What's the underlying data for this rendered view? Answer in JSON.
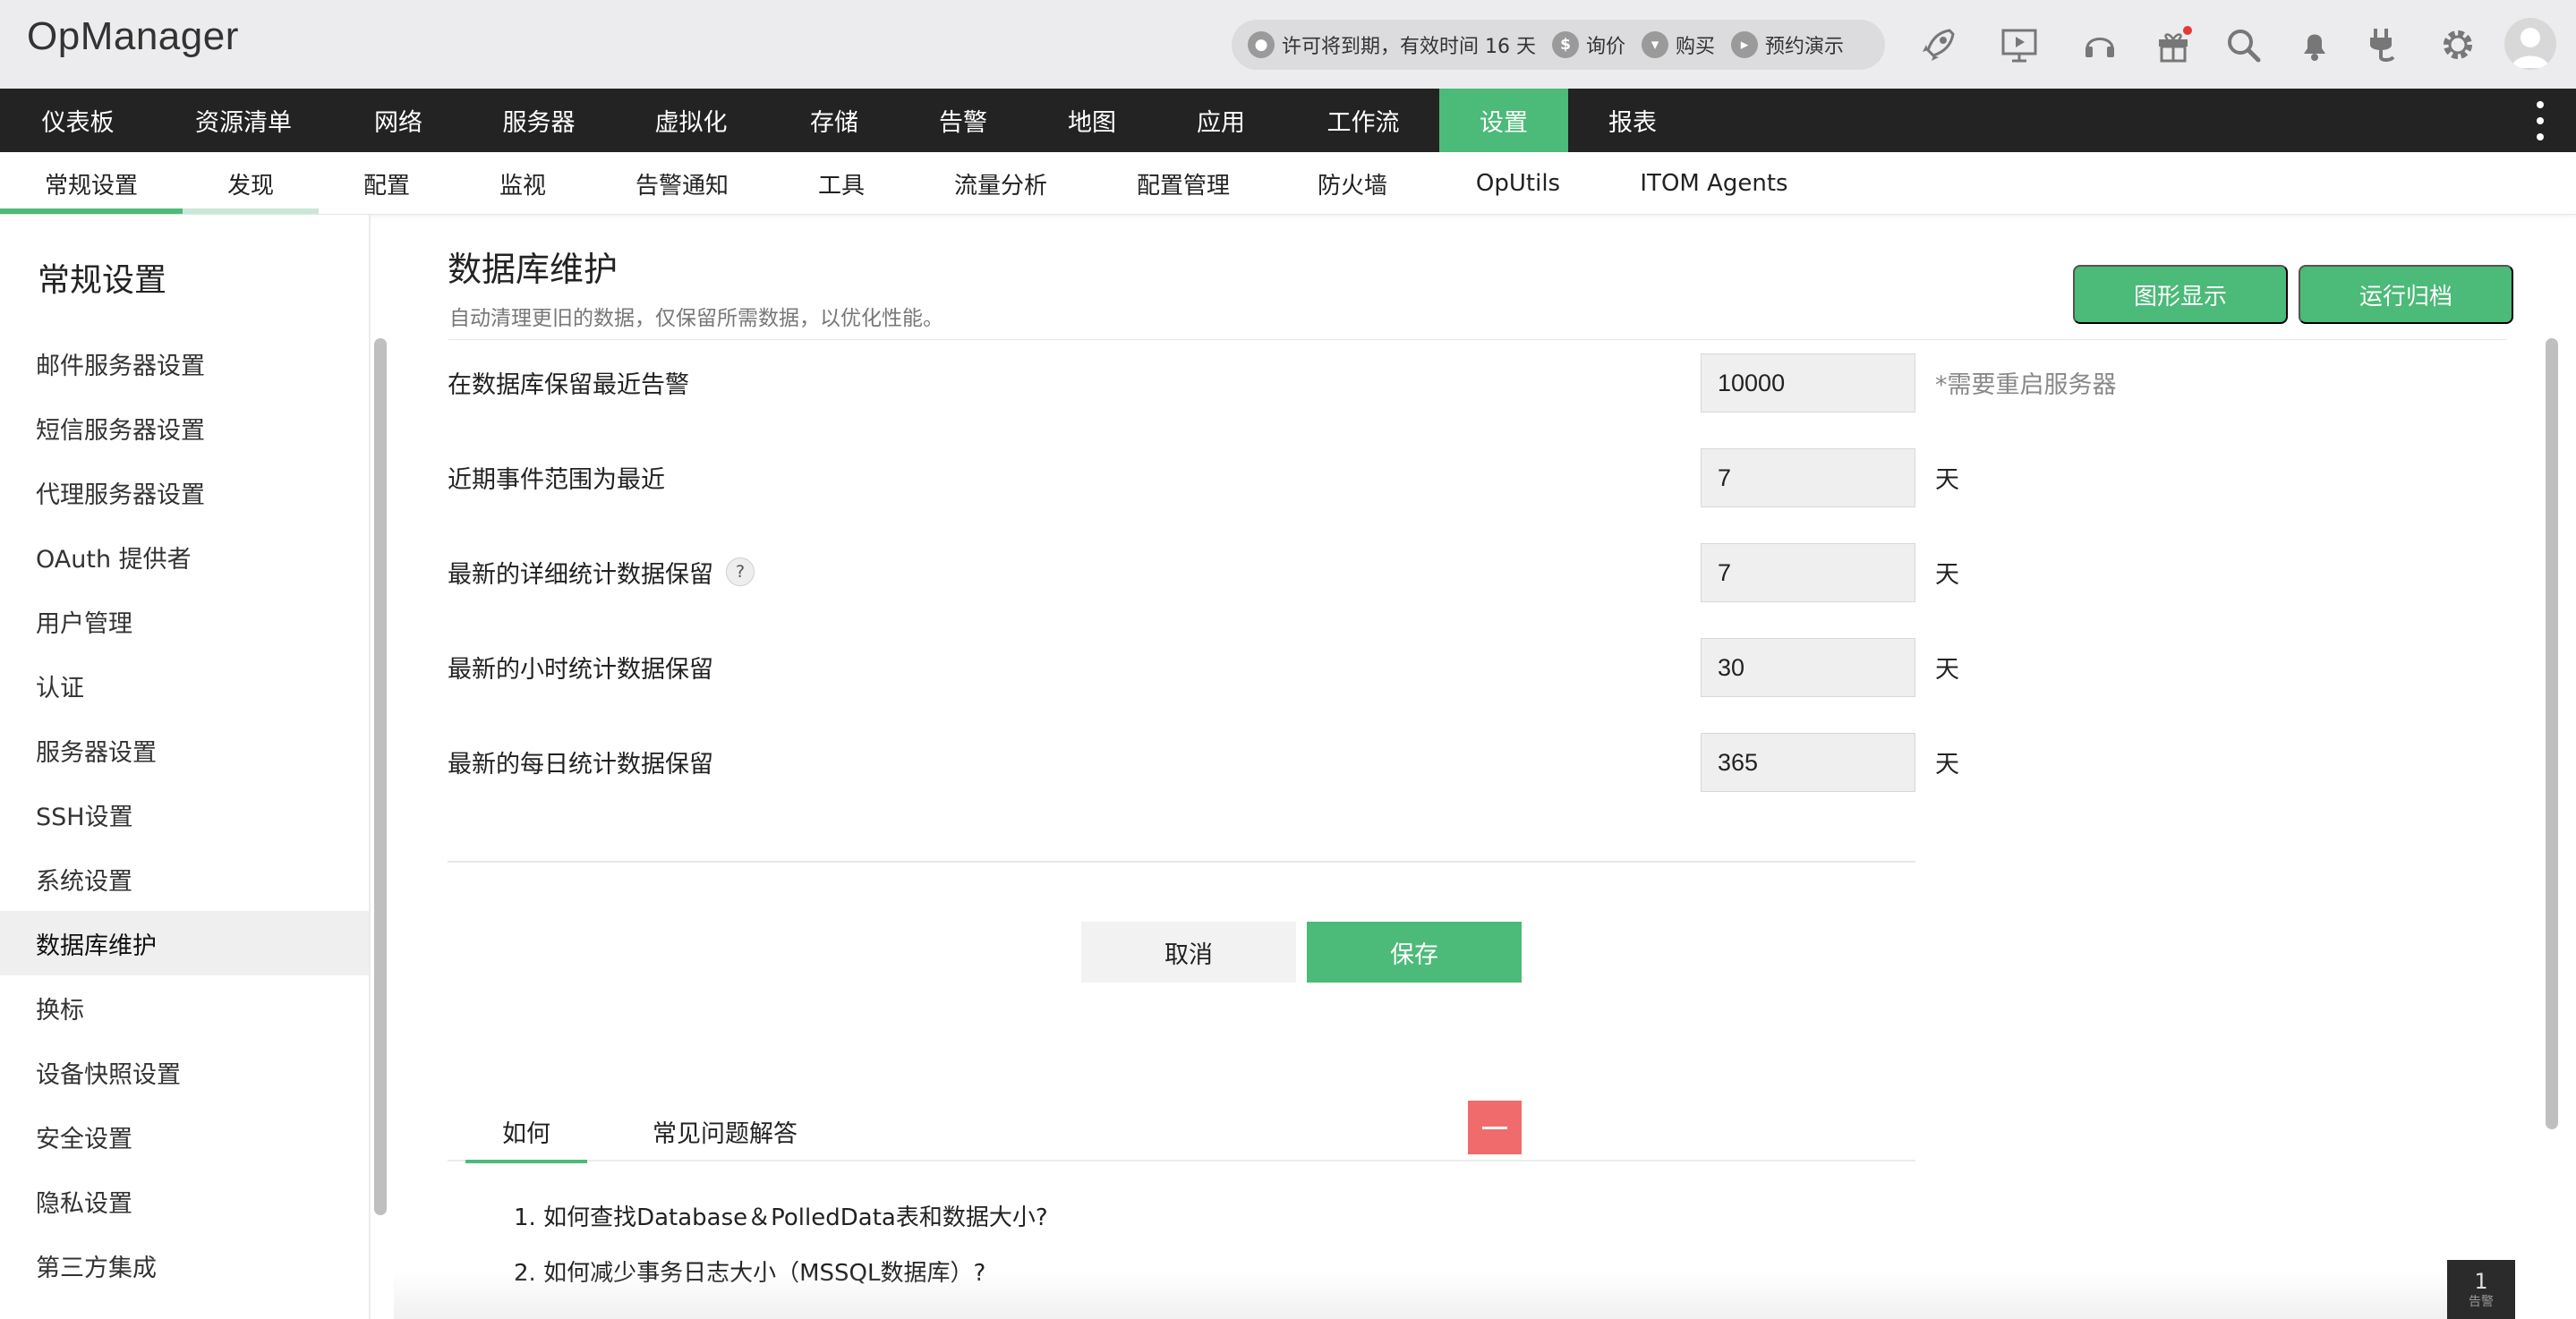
{
  "app": {
    "logo": "OpManager"
  },
  "license": {
    "text": "许可将到期，有效时间 16 天",
    "inquiry": "询价",
    "buy": "购买",
    "demo": "预约演示"
  },
  "header_icons": [
    "rocket-icon",
    "presentation-icon",
    "headset-icon",
    "gift-icon",
    "search-icon",
    "bell-icon",
    "plug-icon",
    "gear-icon",
    "user-avatar-icon"
  ],
  "main_nav": {
    "items": [
      "仪表板",
      "资源清单",
      "网络",
      "服务器",
      "虚拟化",
      "存储",
      "告警",
      "地图",
      "应用",
      "工作流",
      "设置",
      "报表"
    ],
    "active": "设置"
  },
  "sub_nav": {
    "items": [
      "常规设置",
      "发现",
      "配置",
      "监视",
      "告警通知",
      "工具",
      "流量分析",
      "配置管理",
      "防火墙",
      "OpUtils",
      "ITOM Agents"
    ],
    "active": "常规设置"
  },
  "sidebar": {
    "title": "常规设置",
    "items": [
      "邮件服务器设置",
      "短信服务器设置",
      "代理服务器设置",
      "OAuth 提供者",
      "用户管理",
      "认证",
      "服务器设置",
      "SSH设置",
      "系统设置",
      "数据库维护",
      "换标",
      "设备快照设置",
      "安全设置",
      "隐私设置",
      "第三方集成"
    ],
    "active": "数据库维护"
  },
  "page": {
    "title": "数据库维护",
    "description": "自动清理更旧的数据，仅保留所需数据，以优化性能。",
    "graph_button": "图形显示",
    "archive_button": "运行归档"
  },
  "form": {
    "rows": [
      {
        "label": "在数据库保留最近告警",
        "value": "10000",
        "suffix": "*需要重启服务器"
      },
      {
        "label": "近期事件范围为最近",
        "value": "7",
        "suffix": "天"
      },
      {
        "label": "最新的详细统计数据保留",
        "value": "7",
        "suffix": "天",
        "help": "?"
      },
      {
        "label": "最新的小时统计数据保留",
        "value": "30",
        "suffix": "天"
      },
      {
        "label": "最新的每日统计数据保留",
        "value": "365",
        "suffix": "天"
      }
    ],
    "cancel": "取消",
    "save": "保存"
  },
  "help": {
    "tabs": [
      "如何",
      "常见问题解答"
    ],
    "active_tab": "如何",
    "faq": [
      "1. 如何查找Database＆PolledData表和数据大小?",
      "2. 如何减少事务日志大小（MSSQL数据库）?"
    ]
  },
  "alarm_badge": {
    "count": "1",
    "label": "告警"
  },
  "colors": {
    "accent": "#4cba78",
    "nav_bg": "#232323",
    "danger": "#f06b6b"
  }
}
